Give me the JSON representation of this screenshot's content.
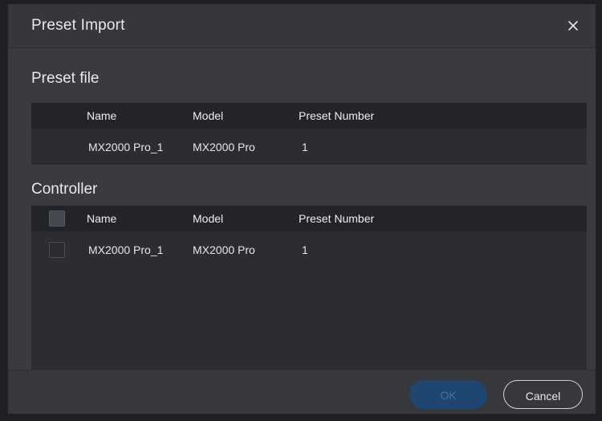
{
  "dialog": {
    "title": "Preset Import",
    "close_icon": "close-icon"
  },
  "preset_file": {
    "label": "Preset file",
    "columns": [
      "Name",
      "Model",
      "Preset Number"
    ],
    "rows": [
      {
        "name": "MX2000 Pro_1",
        "model": "MX2000 Pro",
        "preset_number": "1"
      }
    ]
  },
  "controller": {
    "label": "Controller",
    "columns": [
      "Name",
      "Model",
      "Preset Number"
    ],
    "rows": [
      {
        "name": "MX2000 Pro_1",
        "model": "MX2000 Pro",
        "preset_number": "1"
      }
    ]
  },
  "footer": {
    "ok_label": "OK",
    "cancel_label": "Cancel"
  },
  "colors": {
    "ok_button_bg": "#1f4671",
    "dialog_bg": "#393b40"
  }
}
